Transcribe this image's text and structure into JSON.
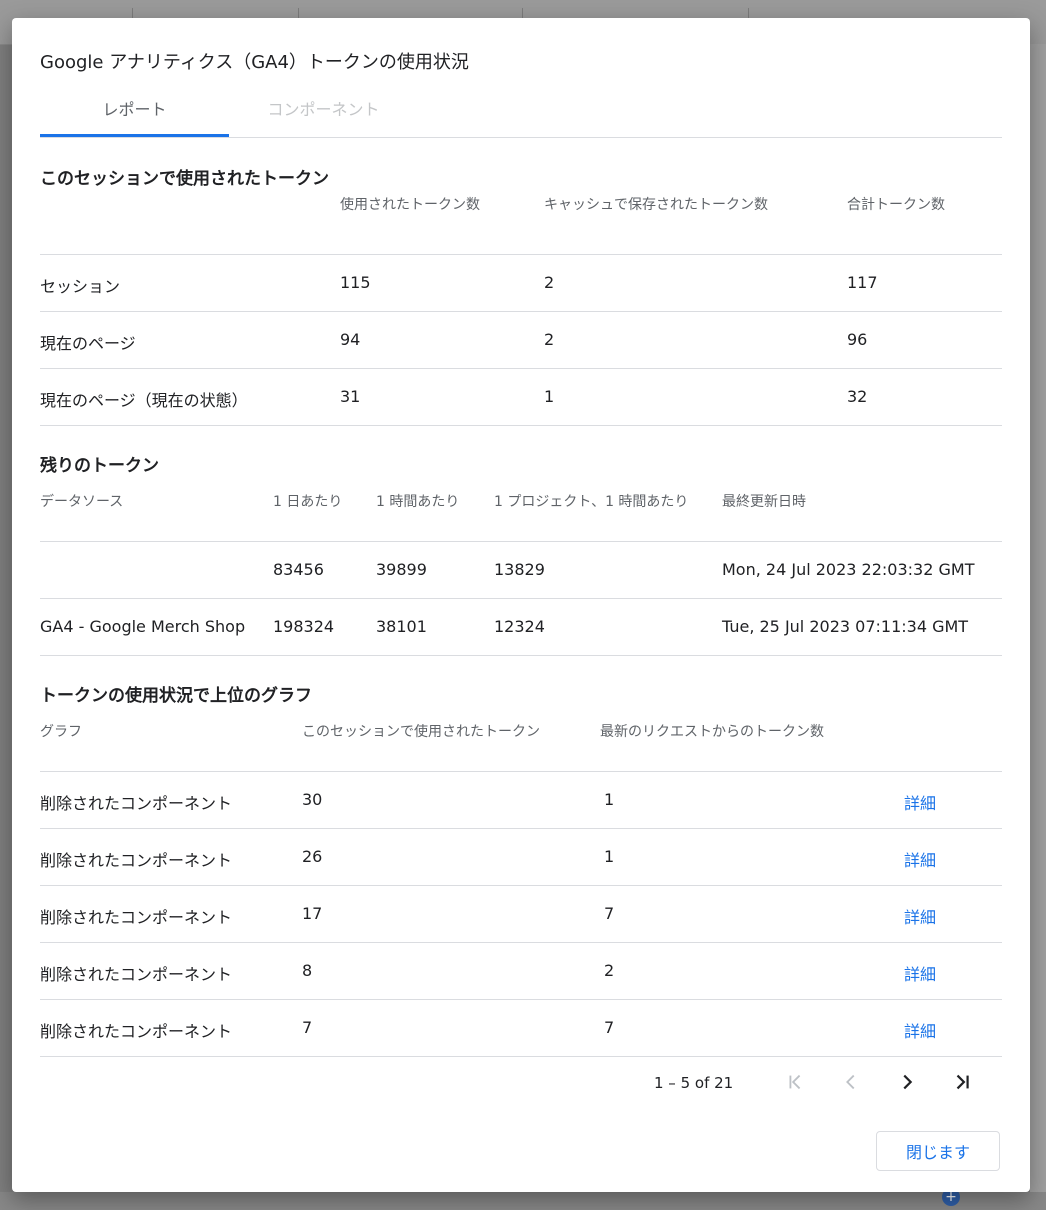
{
  "dialog": {
    "title": "Google アナリティクス（GA4）トークンの使用状況",
    "tabs": [
      {
        "label": "レポート",
        "active": true
      },
      {
        "label": "コンポーネント",
        "active": false
      }
    ],
    "close_label": "閉じます"
  },
  "session_tokens": {
    "title": "このセッションで使用されたトークン",
    "headers": [
      "使用されたトークン数",
      "キャッシュで保存されたトークン数",
      "合計トークン数"
    ],
    "rows": [
      {
        "label": "セッション",
        "used": "115",
        "cached": "2",
        "total": "117"
      },
      {
        "label": "現在のページ",
        "used": "94",
        "cached": "2",
        "total": "96"
      },
      {
        "label": "現在のページ（現在の状態）",
        "used": "31",
        "cached": "1",
        "total": "32"
      }
    ]
  },
  "remaining_tokens": {
    "title": "残りのトークン",
    "headers": [
      "データソース",
      "1 日あたり",
      "1 時間あたり",
      "1 プロジェクト、1 時間あたり",
      "最終更新日時"
    ],
    "rows": [
      {
        "source": "",
        "per_day": "83456",
        "per_hour": "39899",
        "per_project_hour": "13829",
        "updated": "Mon, 24 Jul 2023 22:03:32 GMT"
      },
      {
        "source": "GA4 - Google Merch Shop",
        "per_day": "198324",
        "per_hour": "38101",
        "per_project_hour": "12324",
        "updated": "Tue, 25 Jul 2023 07:11:34 GMT"
      }
    ]
  },
  "top_charts": {
    "title": "トークンの使用状況で上位のグラフ",
    "headers": [
      "グラフ",
      "このセッションで使用されたトークン",
      "最新のリクエストからのトークン数"
    ],
    "details_label": "詳細",
    "rows": [
      {
        "chart": "削除されたコンポーネント",
        "session": "30",
        "latest": "1"
      },
      {
        "chart": "削除されたコンポーネント",
        "session": "26",
        "latest": "1"
      },
      {
        "chart": "削除されたコンポーネント",
        "session": "17",
        "latest": "7"
      },
      {
        "chart": "削除されたコンポーネント",
        "session": "8",
        "latest": "2"
      },
      {
        "chart": "削除されたコンポーネント",
        "session": "7",
        "latest": "7"
      }
    ]
  },
  "pagination": {
    "range_text": "1 – 5 of 21",
    "icons": [
      "first-page-icon",
      "previous-page-icon",
      "next-page-icon",
      "last-page-icon"
    ]
  },
  "colors": {
    "accent": "#1a73e8",
    "divider": "#dadce0",
    "secondary_text": "#5f6368"
  }
}
